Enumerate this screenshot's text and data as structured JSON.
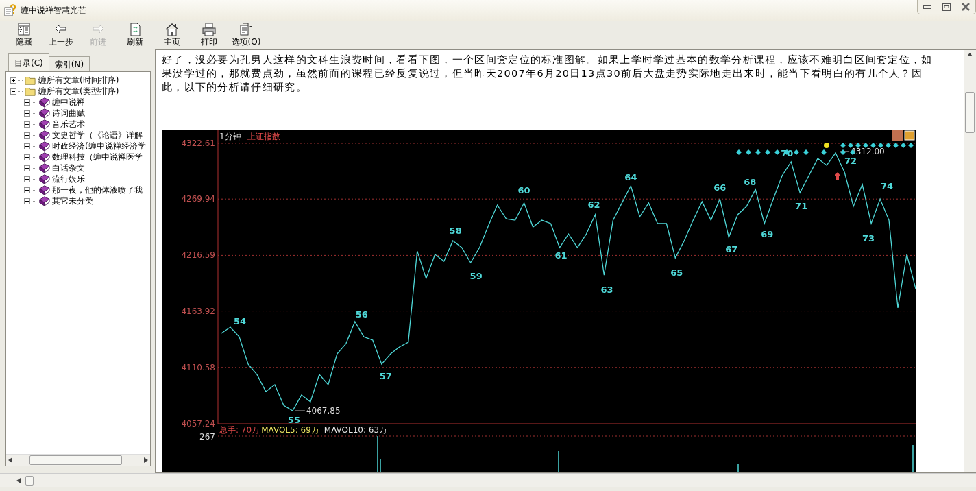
{
  "window": {
    "title": "缠中说禅智慧光芒"
  },
  "toolbar": [
    {
      "kind": "hide",
      "label": "隐藏",
      "disabled": false
    },
    {
      "kind": "back",
      "label": "上一步",
      "disabled": false
    },
    {
      "kind": "forward",
      "label": "前进",
      "disabled": true
    },
    {
      "kind": "refresh",
      "label": "刷新",
      "disabled": false
    },
    {
      "kind": "home",
      "label": "主页",
      "disabled": false
    },
    {
      "kind": "print",
      "label": "打印",
      "disabled": false
    },
    {
      "kind": "options",
      "label": "选项(O)",
      "disabled": false
    }
  ],
  "sidebar": {
    "tabs": [
      {
        "label": "目录(C)",
        "selected": true
      },
      {
        "label": "索引(N)",
        "selected": false
      }
    ],
    "tree": [
      {
        "label": "缠所有文章(时间排序)",
        "kind": "folder",
        "expanded": false
      },
      {
        "label": "缠所有文章(类型排序)",
        "kind": "folder",
        "expanded": true,
        "children": [
          {
            "label": "缠中说禅",
            "kind": "book",
            "expanded": false
          },
          {
            "label": "诗词曲赋",
            "kind": "book",
            "expanded": false
          },
          {
            "label": "音乐艺术",
            "kind": "book",
            "expanded": false
          },
          {
            "label": "文史哲学（《论语》详解",
            "kind": "book",
            "expanded": false
          },
          {
            "label": "时政经济(缠中说禅经济学",
            "kind": "book",
            "expanded": false
          },
          {
            "label": "数理科技（缠中说禅医学",
            "kind": "book",
            "expanded": false
          },
          {
            "label": "白话杂文",
            "kind": "book",
            "expanded": false
          },
          {
            "label": "流行娱乐",
            "kind": "book",
            "expanded": false
          },
          {
            "label": "那一夜，他的体液喷了我",
            "kind": "book",
            "expanded": false
          },
          {
            "label": "其它未分类",
            "kind": "book",
            "expanded": false
          }
        ]
      }
    ]
  },
  "content": {
    "paragraph": "好了，没必要为孔男人这样的文科生浪费时间，看看下图，一个区间套定位的标准图解。如果上学时学过基本的数学分析课程，应该不难明白区间套定位，如果没学过的，那就费点劲，虽然前面的课程已经反复说过，但当昨天2007年6月20日13点30前后大盘走势实际地走出来时，能当下看明白的有几个人？因此，以下的分析请仔细研究。",
    "chart": {
      "period": "1分钟",
      "volume_max_label": "267",
      "volume_legend": [
        {
          "text": "总手: 70万",
          "kind": "total"
        },
        {
          "text": "MAVOL5: 69万",
          "kind": "ma5"
        },
        {
          "text": "MAVOL10: 63万",
          "kind": "ma10"
        }
      ],
      "wave_labels": [
        "54",
        "55",
        "56",
        "57",
        "58",
        "59",
        "60",
        "61",
        "62",
        "63",
        "64",
        "65",
        "66",
        "67",
        "68",
        "69",
        "70",
        "71",
        "72",
        "73",
        "74"
      ],
      "price_marks": [
        "4067.85",
        "4312.00"
      ],
      "chart_data": {
        "type": "line",
        "title": "上证指数",
        "ylim": [
          4057.24,
          4322.61
        ],
        "yticks": [
          4322.61,
          4269.94,
          4216.59,
          4163.92,
          4110.58,
          4057.24
        ],
        "grid": true,
        "categories": [
          null,
          null,
          null,
          null,
          null,
          null,
          null,
          null,
          null,
          null,
          null,
          null,
          null,
          null,
          null,
          null,
          null,
          null,
          null,
          null,
          null,
          null,
          null,
          null,
          null,
          null,
          null,
          null,
          null,
          null,
          null,
          null,
          null,
          null,
          null,
          null,
          null,
          null,
          null,
          null,
          null,
          null,
          null,
          null,
          null,
          null,
          null,
          null,
          null,
          null,
          null,
          null,
          null,
          null,
          null,
          null,
          null,
          null,
          null,
          null,
          null,
          null,
          null,
          null,
          null,
          null,
          null,
          null,
          null,
          null,
          null,
          null,
          null,
          null,
          null,
          null,
          null,
          null,
          null
        ],
        "series": [
          {
            "color": "#4fd8d8",
            "values": [
              4142.9,
              4148.7,
              4139.6,
              4113.7,
              4103.9,
              4087.7,
              4094.2,
              4074.7,
              4069.5,
              4084.5,
              4078.0,
              4103.9,
              4094.2,
              4123.4,
              4133.1,
              4153.9,
              4139.6,
              4136.4,
              4113.7,
              4123.4,
              4129.9,
              4134.4,
              4220.7,
              4194.8,
              4217.5,
              4211.0,
              4230.5,
              4224.0,
              4209.7,
              4224.0,
              4244.7,
              4264.2,
              4251.2,
              4249.9,
              4266.2,
              4243.4,
              4249.9,
              4246.7,
              4224.0,
              4236.9,
              4224.0,
              4236.9,
              4255.1,
              4198.0,
              4249.9,
              4266.2,
              4282.4,
              4253.2,
              4266.2,
              4246.7,
              4246.7,
              4214.2,
              4230.5,
              4249.9,
              4267.4,
              4249.9,
              4269.9,
              4233.7,
              4255.1,
              4262.9,
              4279.1,
              4246.7,
              4269.9,
              4292.1,
              4305.1,
              4275.9,
              4292.1,
              4308.3,
              4301.8,
              4313.5,
              4295.4,
              4262.9,
              4283.7,
              4246.7,
              4269.9,
              4249.9,
              4166.9,
              4217.5,
              4185.0
            ]
          }
        ]
      }
    }
  }
}
